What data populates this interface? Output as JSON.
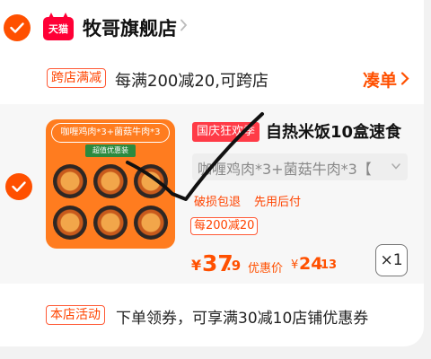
{
  "store": {
    "logo_text": "天猫",
    "name": "牧哥旗舰店"
  },
  "cross_promo": {
    "tag": "跨店满减",
    "text": "每满200减20,可跨店",
    "action": "凑单"
  },
  "product": {
    "thumb_title": "咖喱鸡肉*3+菌菇牛肉*3",
    "thumb_sub": "超值优惠装",
    "badge": "国庆狂欢季",
    "title": "自热米饭10盒速食",
    "sku": "咖喱鸡肉*3+菌菇牛肉*3【",
    "services": [
      "破损包退",
      "先用后付"
    ],
    "deal_tag": "每200减20",
    "price_currency": "¥",
    "price_main": "37",
    "price_decimal": ".9",
    "coupon_label": "优惠价",
    "coupon_currency": "¥",
    "coupon_main": "24",
    "coupon_decimal": ".13",
    "quantity": "×1"
  },
  "shop_activity": {
    "tag": "本店活动",
    "text": "下单领券，可享满30减10店铺优惠券"
  },
  "colors": {
    "accent": "#ff5000",
    "tmall_red": "#ff0036",
    "badge_red": "#ff3b47",
    "thumb_orange": "#ff7c1f"
  }
}
